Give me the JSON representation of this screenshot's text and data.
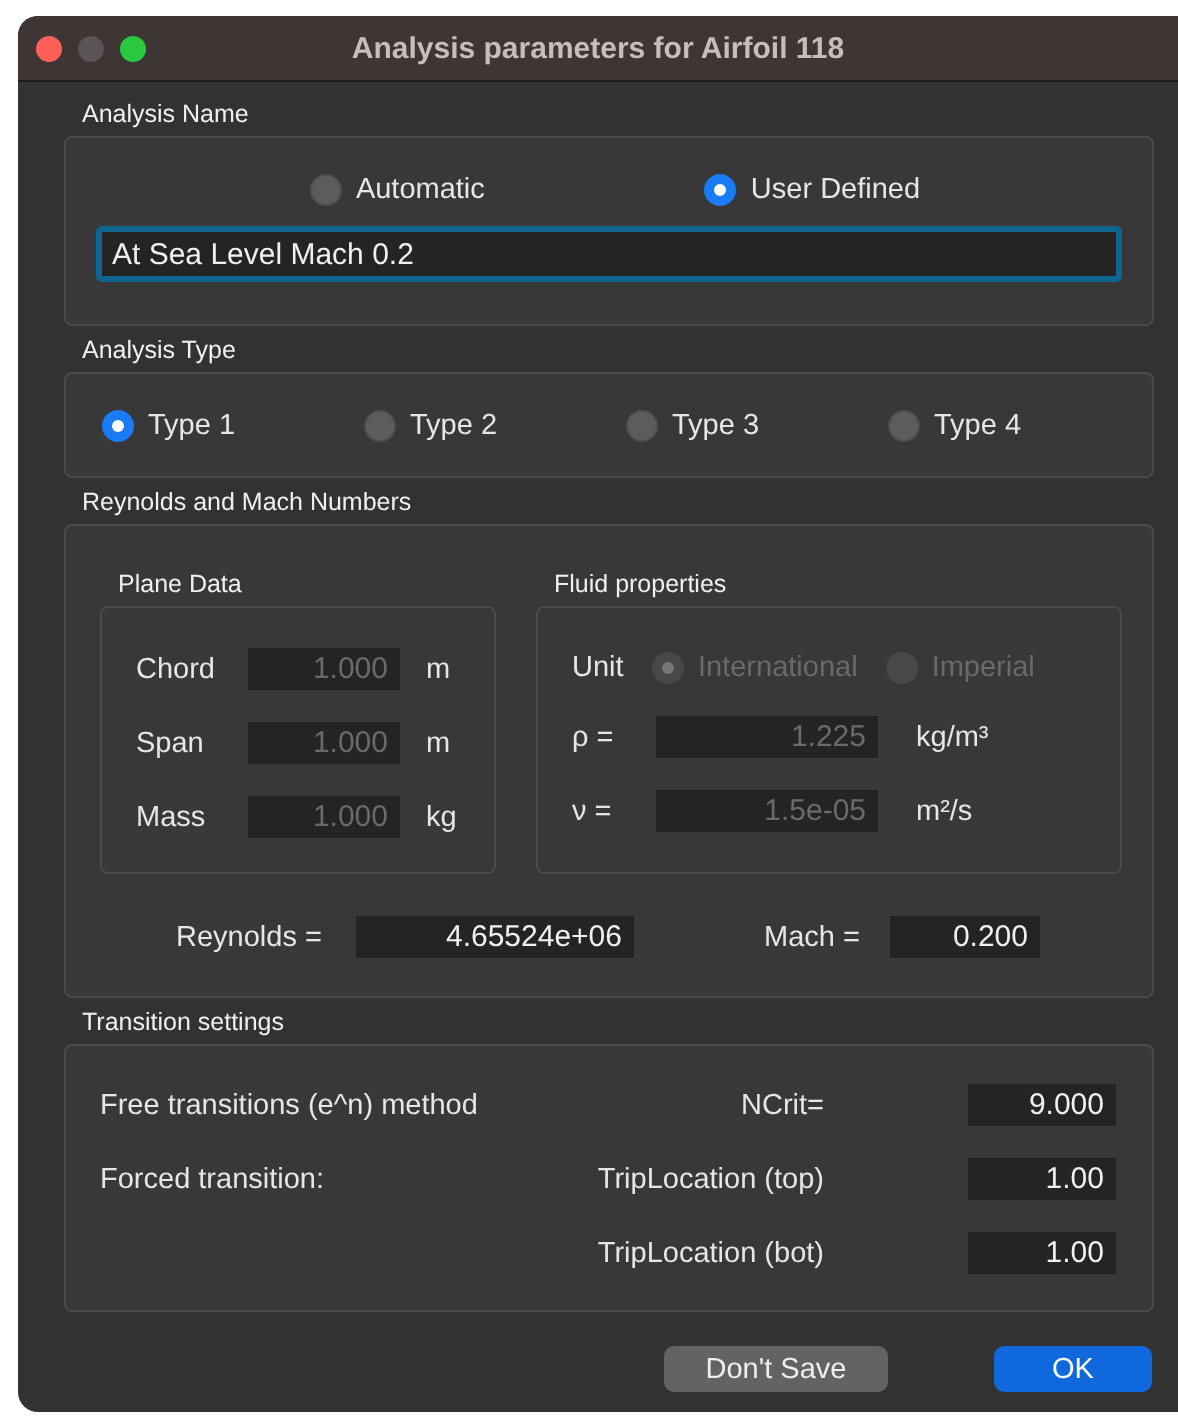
{
  "window": {
    "title": "Analysis parameters for Airfoil 118"
  },
  "analysis_name": {
    "label": "Analysis Name",
    "options": [
      {
        "label": "Automatic",
        "selected": false
      },
      {
        "label": "User Defined",
        "selected": true
      }
    ],
    "name_field": {
      "value": "At Sea Level Mach 0.2",
      "focused": true
    }
  },
  "analysis_type": {
    "label": "Analysis Type",
    "options": [
      {
        "label": "Type 1",
        "selected": true
      },
      {
        "label": "Type 2",
        "selected": false
      },
      {
        "label": "Type 3",
        "selected": false
      },
      {
        "label": "Type 4",
        "selected": false
      }
    ]
  },
  "reynolds_mach": {
    "label": "Reynolds and Mach Numbers",
    "plane_data": {
      "label": "Plane Data",
      "rows": [
        {
          "label": "Chord",
          "value": "1.000",
          "unit": "m",
          "disabled": true
        },
        {
          "label": "Span",
          "value": "1.000",
          "unit": "m",
          "disabled": true
        },
        {
          "label": "Mass",
          "value": "1.000",
          "unit": "kg",
          "disabled": true
        }
      ]
    },
    "fluid": {
      "label": "Fluid properties",
      "unit_label": "Unit",
      "unit_options": [
        {
          "label": "International",
          "selected": true,
          "disabled": true
        },
        {
          "label": "Imperial",
          "selected": false,
          "disabled": true
        }
      ],
      "rows": [
        {
          "label": "ρ =",
          "value": "1.225",
          "unit": "kg/m³",
          "disabled": true
        },
        {
          "label": "ν =",
          "value": "1.5e-05",
          "unit": "m²/s",
          "disabled": true
        }
      ]
    },
    "reynolds": {
      "label": "Reynolds =",
      "value": "4.65524e+06"
    },
    "mach": {
      "label": "Mach =",
      "value": "0.200"
    }
  },
  "transition": {
    "label": "Transition settings",
    "rows": [
      {
        "label": "Free transitions (e^n) method",
        "field_label": "NCrit=",
        "value": "9.000"
      },
      {
        "label": "Forced transition:",
        "field_label": "TripLocation (top)",
        "value": "1.00"
      },
      {
        "field_label": "TripLocation (bot)",
        "value": "1.00"
      }
    ]
  },
  "buttons": [
    {
      "label": "Don't Save",
      "kind": "secondary"
    },
    {
      "label": "OK",
      "kind": "default"
    }
  ]
}
